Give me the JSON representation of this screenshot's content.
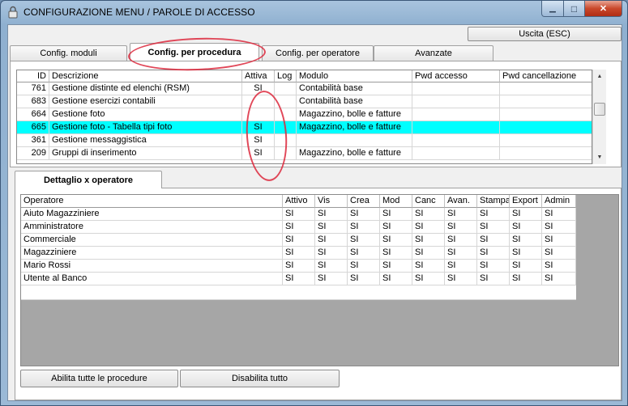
{
  "window": {
    "title": "CONFIGURAZIONE MENU / PAROLE DI ACCESSO",
    "minimize_glyph": "▁",
    "maximize_glyph": "□",
    "close_glyph": "✕"
  },
  "toolbar": {
    "exit_label": "Uscita (ESC)"
  },
  "tabs": [
    {
      "label": "Config. moduli"
    },
    {
      "label": "Config. per procedura"
    },
    {
      "label": "Config. per operatore"
    },
    {
      "label": "Avanzate"
    }
  ],
  "procedures_table": {
    "columns": [
      "ID",
      "Descrizione",
      "Attiva",
      "Log",
      "Modulo",
      "Pwd accesso",
      "Pwd cancellazione"
    ],
    "rows": [
      {
        "id": "761",
        "descrizione": "Gestione distinte ed elenchi (RSM)",
        "attiva": "SI",
        "log": "",
        "modulo": "Contabilità base",
        "pwd_accesso": "",
        "pwd_cancellazione": ""
      },
      {
        "id": "683",
        "descrizione": "Gestione esercizi contabili",
        "attiva": "",
        "log": "",
        "modulo": "Contabilità base",
        "pwd_accesso": "",
        "pwd_cancellazione": ""
      },
      {
        "id": "664",
        "descrizione": "Gestione foto",
        "attiva": "",
        "log": "",
        "modulo": "Magazzino, bolle e fatture",
        "pwd_accesso": "",
        "pwd_cancellazione": ""
      },
      {
        "id": "665",
        "descrizione": "Gestione foto - Tabella tipi foto",
        "attiva": "SI",
        "log": "",
        "modulo": "Magazzino, bolle e fatture",
        "pwd_accesso": "",
        "pwd_cancellazione": ""
      },
      {
        "id": "361",
        "descrizione": "Gestione messaggistica",
        "attiva": "SI",
        "log": "",
        "modulo": "",
        "pwd_accesso": "",
        "pwd_cancellazione": ""
      },
      {
        "id": "209",
        "descrizione": "Gruppi di inserimento",
        "attiva": "SI",
        "log": "",
        "modulo": "Magazzino, bolle e fatture",
        "pwd_accesso": "",
        "pwd_cancellazione": ""
      }
    ],
    "selected_index": 3
  },
  "detail_tab": {
    "label": "Dettaglio x operatore"
  },
  "operators_table": {
    "columns": [
      "Operatore",
      "Attivo",
      "Vis",
      "Crea",
      "Mod",
      "Canc",
      "Avan.",
      "Stampa",
      "Export",
      "Admin"
    ],
    "rows": [
      {
        "name": "Aiuto Magazziniere",
        "values": [
          "SI",
          "SI",
          "SI",
          "SI",
          "SI",
          "SI",
          "SI",
          "SI",
          "SI"
        ]
      },
      {
        "name": "Amministratore",
        "values": [
          "SI",
          "SI",
          "SI",
          "SI",
          "SI",
          "SI",
          "SI",
          "SI",
          "SI"
        ]
      },
      {
        "name": "Commerciale",
        "values": [
          "SI",
          "SI",
          "SI",
          "SI",
          "SI",
          "SI",
          "SI",
          "SI",
          "SI"
        ]
      },
      {
        "name": "Magazziniere",
        "values": [
          "SI",
          "SI",
          "SI",
          "SI",
          "SI",
          "SI",
          "SI",
          "SI",
          "SI"
        ]
      },
      {
        "name": "Mario Rossi",
        "values": [
          "SI",
          "SI",
          "SI",
          "SI",
          "SI",
          "SI",
          "SI",
          "SI",
          "SI"
        ]
      },
      {
        "name": "Utente al Banco",
        "values": [
          "SI",
          "SI",
          "SI",
          "SI",
          "SI",
          "SI",
          "SI",
          "SI",
          "SI"
        ]
      }
    ]
  },
  "footer": {
    "enable_all_label": "Abilita tutte le procedure",
    "disable_all_label": "Disabilita tutto"
  },
  "colors": {
    "selection": "#00ffff",
    "annotation": "#dc283c"
  }
}
